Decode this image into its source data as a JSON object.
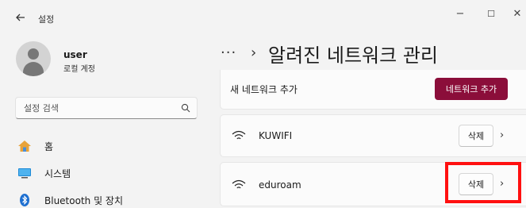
{
  "window": {
    "app_title": "설정",
    "back_icon": "back-arrow-icon",
    "minimize_glyph": "−",
    "maximize_glyph": "☐",
    "close_glyph": "✕"
  },
  "sidebar": {
    "user": {
      "name": "user",
      "account_type": "로컬 계정",
      "icon": "avatar-icon"
    },
    "search": {
      "placeholder": "설정 검색",
      "icon": "search-icon"
    },
    "nav_items": [
      {
        "label": "홈",
        "icon": "home-icon"
      },
      {
        "label": "시스템",
        "icon": "system-monitor-icon"
      },
      {
        "label": "Bluetooth 및 장치",
        "icon": "bluetooth-icon"
      }
    ]
  },
  "main": {
    "breadcrumb": {
      "more": "···",
      "separator": "›"
    },
    "title": "알려진 네트워크 관리",
    "add_network": {
      "label": "새 네트워크 추가",
      "button_label": "네트워크 추가"
    },
    "networks": [
      {
        "name": "KUWIFI",
        "delete_label": "삭제",
        "chevron": "›"
      },
      {
        "name": "eduroam",
        "delete_label": "삭제",
        "chevron": "›"
      }
    ]
  },
  "colors": {
    "accent": "#8b0e3a",
    "highlight": "#ff1010",
    "background": "#f3f3f3",
    "card": "#fbfbfb"
  }
}
